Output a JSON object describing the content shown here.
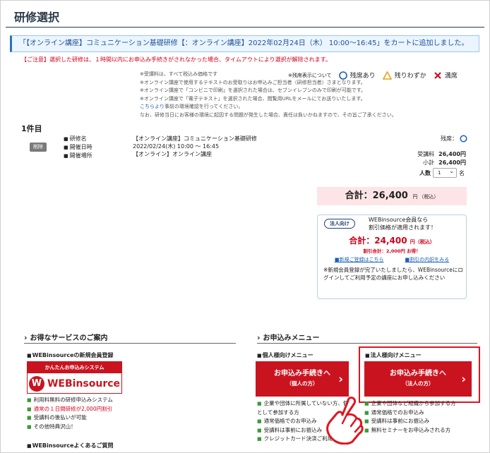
{
  "page_title": "研修選択",
  "notice": "「【オンライン講座】コミュニケーション基礎研修【：オンライン講座】2022年02月24日（木） 10:00～16:45」をカートに追加しました。",
  "warning": "【ご注意】選択した研修は、１時間以内にお申込み手続きがされなかった場合、タイムアウトにより選択が解除されます。",
  "legend": {
    "label": "※残席表示について",
    "items": [
      "残席あり",
      "残りわずか",
      "満席"
    ]
  },
  "notes": [
    "※受講料は、すべて税込み価格です",
    "※オンライン講座で使用するテキストのお受取りはお申込みご担当者（研修担当者）さまとなります。",
    "※オンライン講座で「コンビニで印刷」を選択された場合は、セブンイレブンのみで印刷が可能です。",
    "※オンライン講座で「電子テキスト」を選択された場合、閲覧用URLをメールにてお送りいたします。",
    "事前の環境確認を行ってください。",
    "なお、研修当日にお客様の環境に起因する問題が発生した場合、責任は負いかねますので、その旨ご了承ください。"
  ],
  "notes_link": "こちらより",
  "count": "1件目",
  "delete_label": "削除",
  "item": {
    "keys": [
      "研修名",
      "開催日時",
      "開催場所"
    ],
    "values": [
      "【オンライン講座】コミュニケーション基礎研修",
      "2022/02/24(木) 10:00 ～ 16:45",
      "【オンライン】オンライン講座"
    ],
    "vacancy_label": "残席："
  },
  "prices": {
    "fee_label": "受講料",
    "fee": "26,400円",
    "subtotal_label": "小計",
    "subtotal": "26,400円",
    "qty_label": "人数",
    "qty": "1",
    "qty_unit": "名"
  },
  "total": {
    "label": "合計：26,400",
    "unit": "円",
    "tax": "（税込）"
  },
  "corp": {
    "badge": "法人向け",
    "msg1": "WEBinsource会員なら",
    "msg2": "割引価格が適用されます！",
    "total": "合計：24,400",
    "unit": "円",
    "tax": "（税込）",
    "discount": "割引合計：2,000円 お得！",
    "link1": "■新規ご登録はこちら",
    "link2": "■割引の内訳をみる",
    "note": "新規会員登録が完了いたしましたら、WEBinsourceにログインしてご利用予定の講座にお申し込みください"
  },
  "services": {
    "heading": "お得なサービスのご案内",
    "sub1": "WEBinsourceの新規会員登録",
    "banner_top": "かんたんお申込みシステム",
    "banner_logo": "WEBinsource",
    "bullets": [
      "利用料無料の研修申込みシステム",
      "通常の１日間研修が2,000円割引",
      "受講料の後払いが可能",
      "その他特典沢山！"
    ],
    "sub2": "WEBinsourceよくあるご質問"
  },
  "apply": {
    "heading": "お申込みメニュー",
    "personal_head": "個人様向けメニュー",
    "personal_l1": "お申込み手続きへ",
    "personal_l2": "（個人の方）",
    "personal_bullets": [
      "企業や団体に所属していない方、個人として参加する方",
      "通常価格でのお申込み",
      "受講料は事前にお振込み",
      "クレジットカード決済ご利用"
    ],
    "corp_head": "法人様向けメニュー",
    "corp_l1": "お申込み手続きへ",
    "corp_l2": "（法人の方）",
    "corp_bullets": [
      "企業や団体など組織から参加する方",
      "通常価格でのお申込み",
      "受講料は事前にお振込み",
      "無料セミナーをお申込みされる方"
    ]
  },
  "colors": {
    "accent_red": "#c9141f",
    "navy": "#243a5e",
    "link_blue": "#1a5fb4",
    "pink": "#fde5e7"
  }
}
